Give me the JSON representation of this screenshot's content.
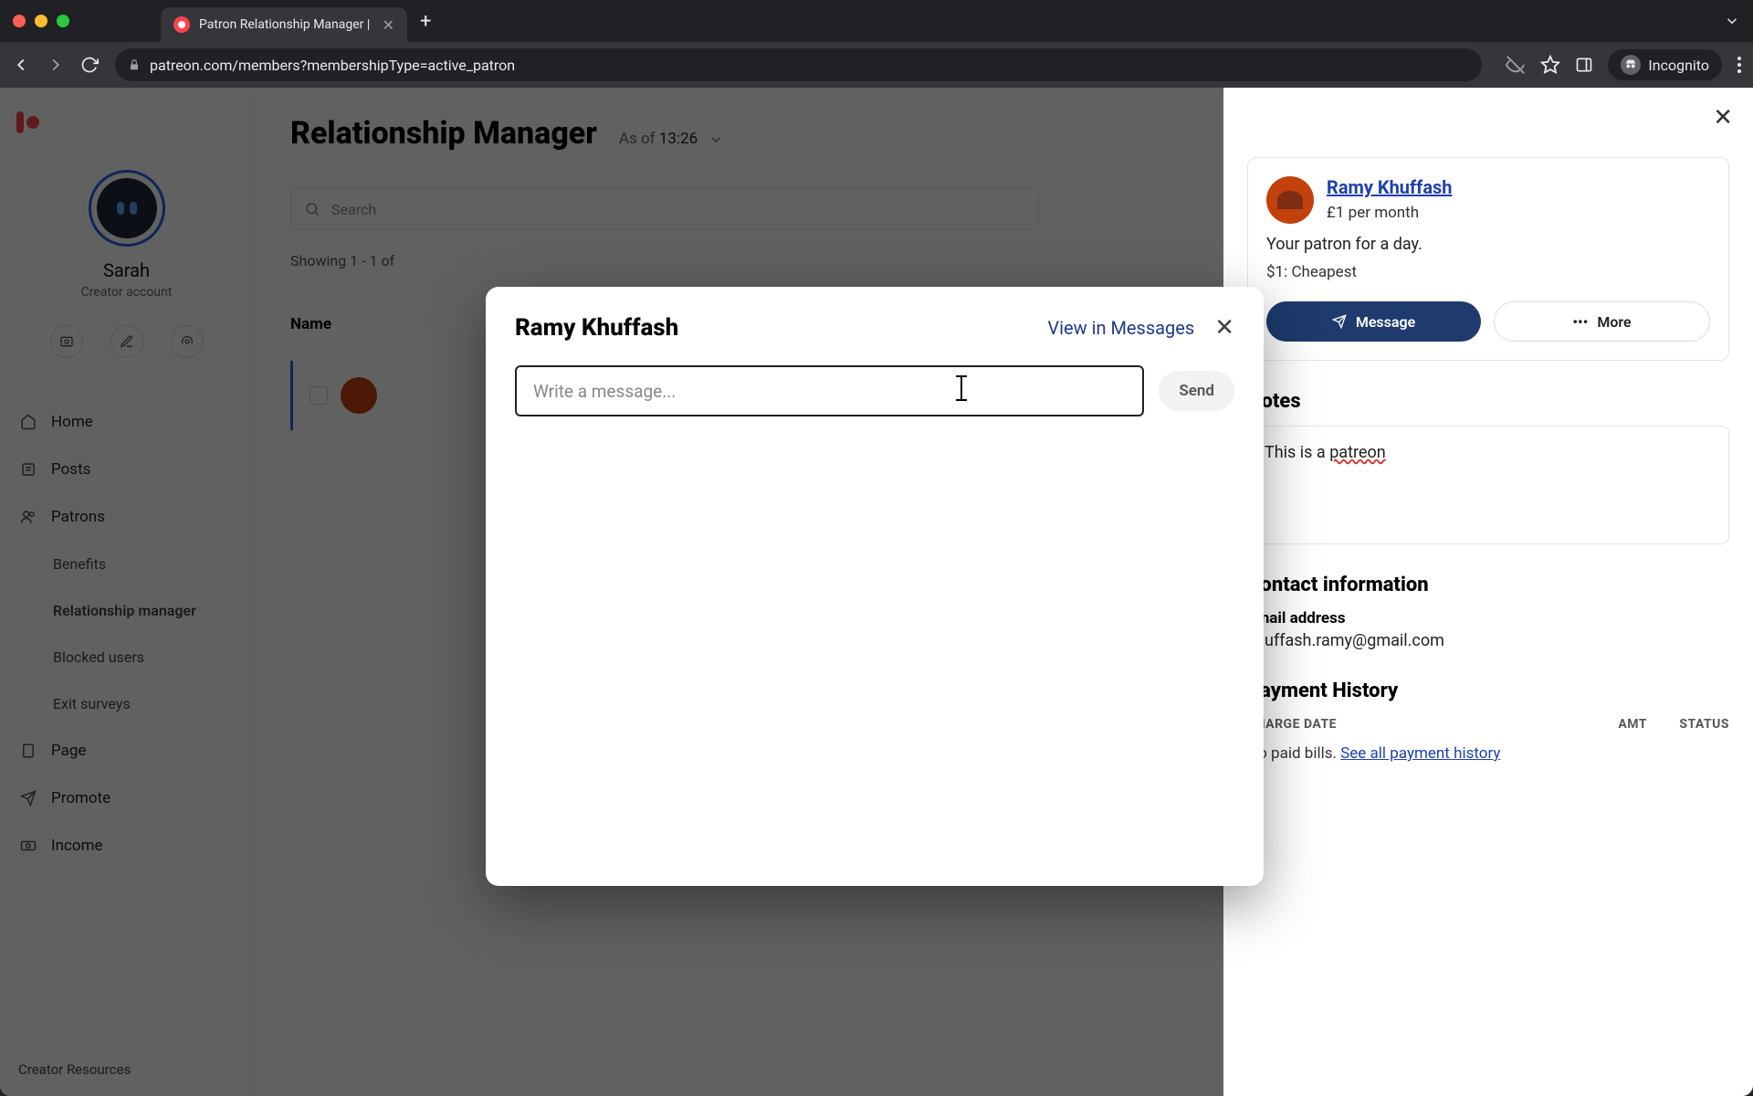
{
  "browser": {
    "tab_title": "Patron Relationship Manager |",
    "url": "patreon.com/members?membershipType=active_patron",
    "incognito_label": "Incognito"
  },
  "sidebar": {
    "profile_name": "Sarah",
    "profile_sub": "Creator account",
    "items": [
      {
        "icon": "home-icon",
        "label": "Home"
      },
      {
        "icon": "posts-icon",
        "label": "Posts"
      },
      {
        "icon": "patrons-icon",
        "label": "Patrons"
      }
    ],
    "sub_items": [
      {
        "label": "Benefits"
      },
      {
        "label": "Relationship manager",
        "active": true
      },
      {
        "label": "Blocked users"
      },
      {
        "label": "Exit surveys"
      }
    ],
    "items2": [
      {
        "icon": "page-icon",
        "label": "Page"
      },
      {
        "icon": "promote-icon",
        "label": "Promote"
      },
      {
        "icon": "income-icon",
        "label": "Income"
      }
    ],
    "footer": "Creator Resources"
  },
  "main": {
    "title": "Relationship Manager",
    "asof_prefix": "As of",
    "asof_time": "13:26",
    "search_placeholder": "Search",
    "showing": "Showing 1 - 1 of",
    "col_name": "Name"
  },
  "panel": {
    "name": "Ramy Khuffash",
    "pledge": "£1 per month",
    "since": "Your patron for a day.",
    "tier": "$1: Cheapest",
    "btn_message": "Message",
    "btn_more": "More",
    "notes_h": "Notes",
    "notes_text_pre": "This is a ",
    "notes_text_u": "patreon",
    "contact_h": "Contact information",
    "email_label": "Email address",
    "email_value": "khuffash.ramy@gmail.com",
    "payment_h": "Payment History",
    "pay_c1": "CHARGE DATE",
    "pay_c2": "AMT",
    "pay_c3": "STATUS",
    "pay_empty": "No paid bills. ",
    "pay_link": "See all payment history"
  },
  "modal": {
    "title": "Ramy Khuffash",
    "view_link": "View in Messages",
    "placeholder": "Write a message...",
    "send": "Send"
  }
}
